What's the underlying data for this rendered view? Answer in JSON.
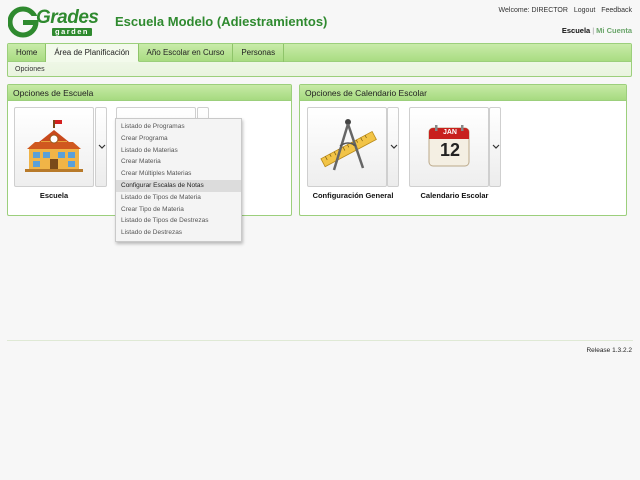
{
  "header": {
    "logo": {
      "brand": "Grades",
      "sub": "garden"
    },
    "school_title": "Escuela Modelo (Adiestramientos)",
    "top_links": {
      "welcome": "Welcome: DIRECTOR",
      "logout": "Logout",
      "feedback": "Feedback"
    },
    "user_links": {
      "school": "Escuela",
      "separator": "|",
      "account": "Mi Cuenta"
    }
  },
  "nav": {
    "tabs": [
      {
        "label": "Home"
      },
      {
        "label": "Área de Planificación"
      },
      {
        "label": "Año Escolar en Curso"
      },
      {
        "label": "Personas"
      }
    ],
    "active_tab": 1,
    "subnav": "Opciones"
  },
  "panels": {
    "school": {
      "title": "Opciones de Escuela",
      "tiles": [
        {
          "label": "Escuela",
          "icon": "school-building-icon"
        },
        {
          "label": "",
          "icon": "books-icon"
        }
      ]
    },
    "calendar": {
      "title": "Opciones de Calendario Escolar",
      "tiles": [
        {
          "label": "Configuración General",
          "icon": "drafting-tools-icon"
        },
        {
          "label": "Calendario Escolar",
          "icon": "calendar-icon",
          "month": "JAN",
          "day": "12"
        }
      ]
    }
  },
  "dropdown_menu": {
    "items": [
      "Listado de Programas",
      "Crear Programa",
      "Listado de Materias",
      "Crear Materia",
      "Crear Múltiples Materias",
      "Configurar Escalas de Notas",
      "Listado de Tipos de Materia",
      "Crear Tipo de Materia",
      "Listado de Tipos de Destrezas",
      "Listado de Destrezas"
    ],
    "highlighted_index": 5
  },
  "footer": {
    "release": "Release 1.3.2.2"
  },
  "colors": {
    "brand_green": "#2f8a2f",
    "tab_green": "#a9dc82",
    "border_green": "#9ccf7c"
  }
}
